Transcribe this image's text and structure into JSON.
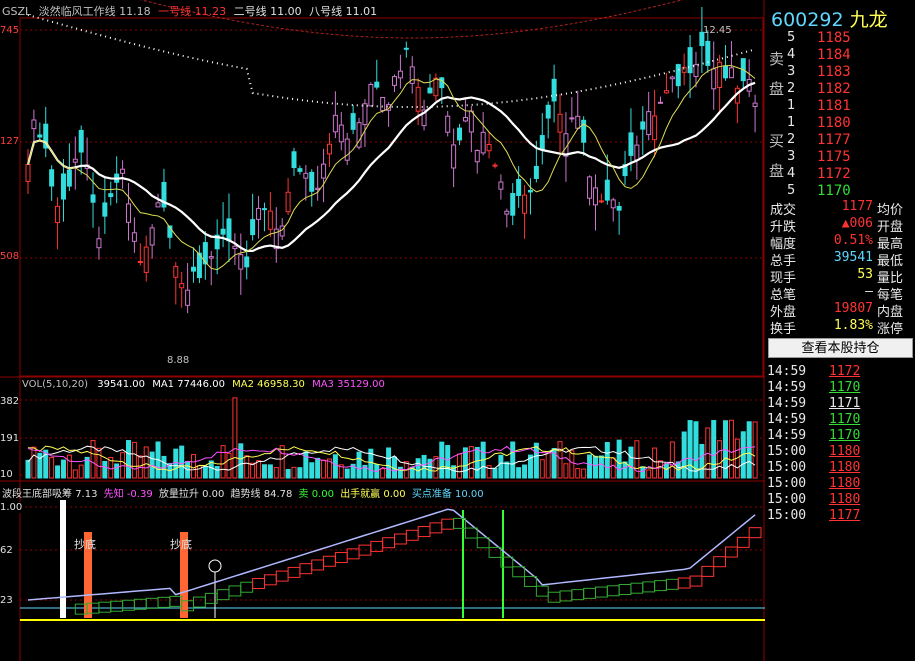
{
  "main": {
    "code": "GSZL",
    "indicator_name": "淡然临风工作线",
    "indicator_value": "11.18",
    "line1_name": "一号线",
    "line1_value": "11.23",
    "line2_name": "二号线",
    "line2_value": "11.00",
    "line8_name": "八号线",
    "line8_value": "11.01",
    "y_label_top": "745",
    "y_label_mid": "127",
    "y_label_low": "508",
    "high_label": "12.45",
    "low_label": "8.88"
  },
  "vol": {
    "title": "VOL(5,10,20)",
    "value": "39541.00",
    "ma1_name": "MA1",
    "ma1_value": "77446.00",
    "ma2_name": "MA2",
    "ma2_value": "46958.30",
    "ma3_name": "MA3",
    "ma3_value": "35129.00",
    "y_label_1": "382",
    "y_label_2": "191",
    "y_label_3": "10"
  },
  "osc": {
    "t1_name": "波段王底部吸筹",
    "t1_value": "7.13",
    "t2_name": "先知",
    "t2_value": "-0.39",
    "t3_name": "放量拉升",
    "t3_value": "0.00",
    "t4_name": "趋势线",
    "t4_value": "84.78",
    "t5_name": "卖",
    "t5_value": "0.00",
    "t6_name": "出手就赢",
    "t6_value": "0.00",
    "t7_name": "买点准备",
    "t7_value": "10.00",
    "y_label_1": "1.00",
    "y_label_2": "62",
    "y_label_3": "23",
    "tag1": "抄底",
    "tag2": "抄底"
  },
  "quote": {
    "code": "600292",
    "name_partial": "九龙",
    "sell_label_1": "卖",
    "sell_label_2": "盘",
    "buy_label_1": "买",
    "buy_label_2": "盘",
    "sells": [
      {
        "lvl": "5",
        "price": "1185"
      },
      {
        "lvl": "4",
        "price": "1184"
      },
      {
        "lvl": "3",
        "price": "1183"
      },
      {
        "lvl": "2",
        "price": "1182"
      },
      {
        "lvl": "1",
        "price": "1181"
      }
    ],
    "buys": [
      {
        "lvl": "1",
        "price": "1180"
      },
      {
        "lvl": "2",
        "price": "1177"
      },
      {
        "lvl": "3",
        "price": "1175"
      },
      {
        "lvl": "4",
        "price": "1172"
      },
      {
        "lvl": "5",
        "price": "1170"
      }
    ],
    "stats": [
      {
        "label": "成交",
        "value": "1177",
        "extra": "均价"
      },
      {
        "label": "升跌",
        "value": "▲006",
        "extra": "开盘"
      },
      {
        "label": "幅度",
        "value": "0.51%",
        "extra": "最高"
      },
      {
        "label": "总手",
        "value": "39541",
        "extra": "最低"
      },
      {
        "label": "现手",
        "value": "53",
        "extra": "量比"
      },
      {
        "label": "总笔",
        "value": "—",
        "extra": "每笔"
      },
      {
        "label": "外盘",
        "value": "19807",
        "extra": "内盘"
      },
      {
        "label": "换手",
        "value": "1.83%",
        "extra": "涨停"
      }
    ],
    "hold_button": "查看本股持仓",
    "ticks": [
      {
        "time": "14:59",
        "price": "1172"
      },
      {
        "time": "14:59",
        "price": "1170"
      },
      {
        "time": "14:59",
        "price": "1171"
      },
      {
        "time": "14:59",
        "price": "1170"
      },
      {
        "time": "14:59",
        "price": "1170"
      },
      {
        "time": "15:00",
        "price": "1180"
      },
      {
        "time": "15:00",
        "price": "1180"
      },
      {
        "time": "15:00",
        "price": "1180"
      },
      {
        "time": "15:00",
        "price": "1180"
      },
      {
        "time": "15:00",
        "price": "1177"
      }
    ],
    "colors": {
      "up": "#ff3333",
      "down": "#33dd33",
      "flat": "#e8e8e8"
    }
  }
}
